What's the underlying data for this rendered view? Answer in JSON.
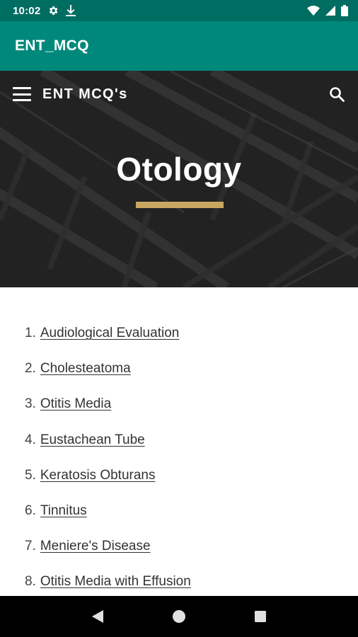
{
  "status_bar": {
    "time": "10:02",
    "icons_left": [
      "gear-icon",
      "download-icon"
    ],
    "icons_right": [
      "wifi-icon",
      "signal-icon",
      "battery-icon"
    ]
  },
  "app_bar": {
    "title": "ENT_MCQ"
  },
  "site_header": {
    "title": "ENT MCQ's",
    "menu_icon": "hamburger-menu-icon",
    "search_icon": "search-icon"
  },
  "hero": {
    "title": "Otology",
    "accent_color": "#c9a760"
  },
  "topics": [
    {
      "number": "1.",
      "label": "Audiological Evaluation"
    },
    {
      "number": "2.",
      "label": "Cholesteatoma"
    },
    {
      "number": "3.",
      "label": "Otitis Media"
    },
    {
      "number": "4.",
      "label": "Eustachean Tube"
    },
    {
      "number": "5.",
      "label": "Keratosis Obturans"
    },
    {
      "number": "6.",
      "label": "Tinnitus"
    },
    {
      "number": "7.",
      "label": "Meniere's Disease"
    },
    {
      "number": "8.",
      "label": "Otitis Media with Effusion"
    }
  ],
  "nav_bar": {
    "buttons": [
      "back-icon",
      "home-icon",
      "recents-icon"
    ]
  },
  "colors": {
    "status_bar": "#006d62",
    "app_bar": "#00897b",
    "hero_bg": "#2b2b2b",
    "accent": "#c9a760"
  }
}
